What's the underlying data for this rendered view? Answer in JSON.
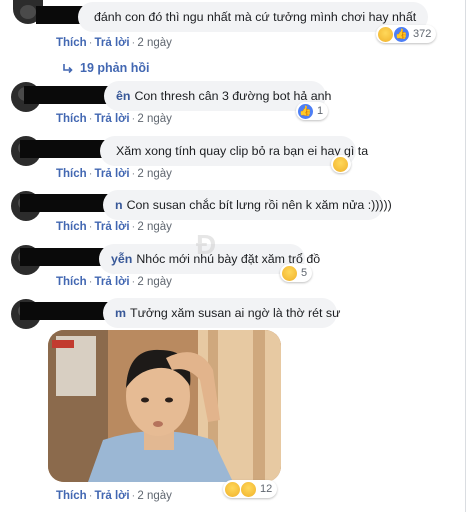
{
  "comments": [
    {
      "name": "",
      "text": "đánh con đó thì ngu nhất mà cứ tưởng mình chơi hay nhất",
      "actions": {
        "like": "Thích",
        "reply": "Trả lời",
        "time": "2 ngày"
      },
      "reactions": {
        "count": "372",
        "icons": [
          "haha-icon",
          "like-icon"
        ]
      }
    },
    {
      "name": "ên",
      "text": "Con thresh cân 3 đường bot hả anh",
      "actions": {
        "like": "Thích",
        "reply": "Trả lời",
        "time": "2 ngày"
      },
      "reactions": {
        "count": "1",
        "icons": [
          "like-icon"
        ]
      }
    },
    {
      "name": "",
      "text": "Xăm xong tính quay clip bỏ ra bạn ei hay gì ta",
      "actions": {
        "like": "Thích",
        "reply": "Trả lời",
        "time": "2 ngày"
      },
      "reactions": {
        "count": "",
        "icons": [
          "haha-icon"
        ]
      }
    },
    {
      "name": "n",
      "text": "Con susan chắc bít lưng rồi nên k xăm nửa :)))))",
      "actions": {
        "like": "Thích",
        "reply": "Trả lời",
        "time": "2 ngày"
      },
      "reactions": null
    },
    {
      "name": "yễn",
      "text": "Nhóc mới nhú bày đặt xăm trổ đồ",
      "actions": {
        "like": "Thích",
        "reply": "Trả lời",
        "time": "2 ngày"
      },
      "reactions": {
        "count": "5",
        "icons": [
          "haha-icon"
        ]
      }
    },
    {
      "name": "m",
      "text": "Tưởng xăm susan ai ngờ là thờ rét sư",
      "actions": {
        "like": "Thích",
        "reply": "Trả lời",
        "time": "2 ngày"
      },
      "reactions": {
        "count": "12",
        "icons": [
          "haha-icon",
          "sad-icon"
        ]
      }
    }
  ],
  "replies_link": "19 phản hồi",
  "watermark": "Đ"
}
